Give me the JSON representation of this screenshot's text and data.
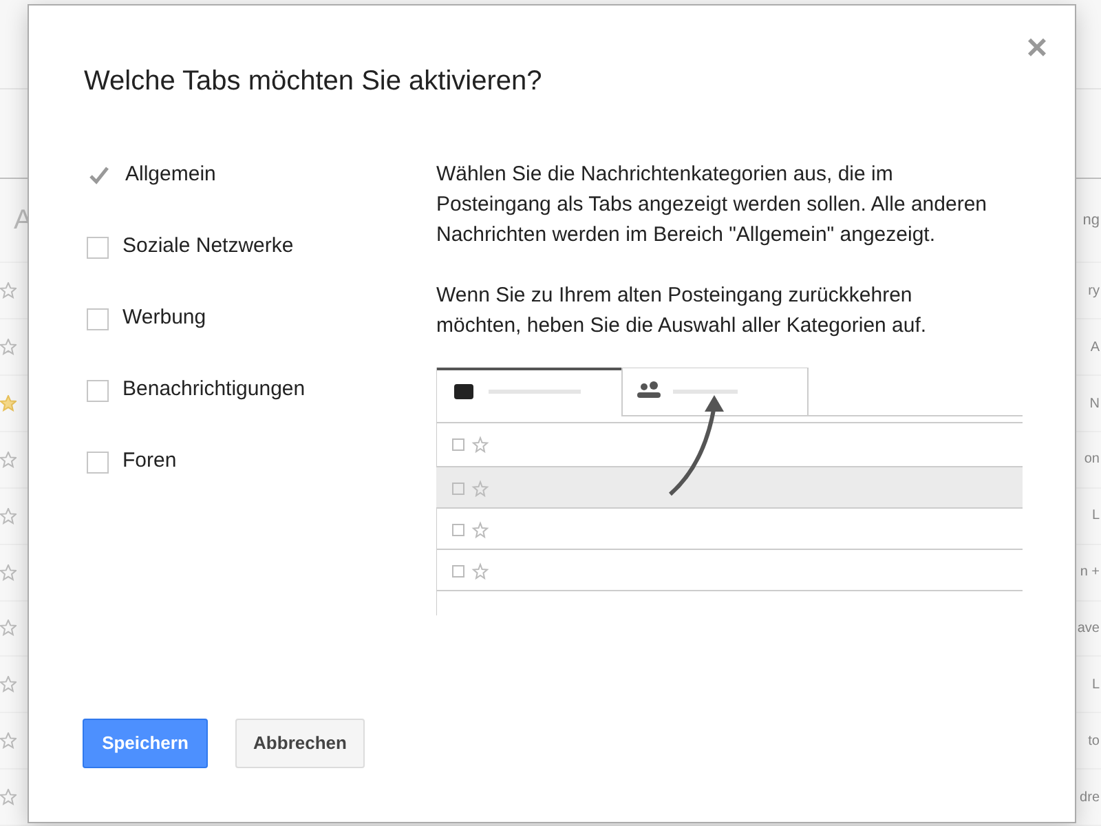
{
  "background": {
    "left_header": "A",
    "right_header": "ng",
    "rows": [
      {
        "starred": false,
        "fragment": "ry"
      },
      {
        "starred": false,
        "fragment": "A"
      },
      {
        "starred": true,
        "fragment": "N"
      },
      {
        "starred": false,
        "fragment": "on"
      },
      {
        "starred": false,
        "fragment": "L"
      },
      {
        "starred": false,
        "fragment": "n +"
      },
      {
        "starred": false,
        "fragment": "ave"
      },
      {
        "starred": false,
        "fragment": "L"
      },
      {
        "starred": false,
        "fragment": "to"
      },
      {
        "starred": false,
        "fragment": "dre"
      }
    ]
  },
  "dialog": {
    "title": "Welche Tabs möchten Sie aktivieren?",
    "close": "×",
    "options": [
      {
        "label": "Allgemein",
        "checked": true,
        "disabled": true
      },
      {
        "label": "Soziale Netzwerke",
        "checked": false,
        "disabled": false
      },
      {
        "label": "Werbung",
        "checked": false,
        "disabled": false
      },
      {
        "label": "Benachrichtigungen",
        "checked": false,
        "disabled": false
      },
      {
        "label": "Foren",
        "checked": false,
        "disabled": false
      }
    ],
    "paragraphs": [
      "Wählen Sie die Nachrichtenkategorien aus, die im Posteingang als Tabs angezeigt werden sollen. Alle anderen Nachrichten werden im Bereich \"Allgemein\" angezeigt.",
      "Wenn Sie zu Ihrem alten Posteingang zurückkehren möchten, heben Sie die Auswahl aller Kategorien auf."
    ],
    "buttons": [
      {
        "label": "Speichern",
        "kind": "primary"
      },
      {
        "label": "Abbrechen",
        "kind": "secondary"
      }
    ]
  }
}
